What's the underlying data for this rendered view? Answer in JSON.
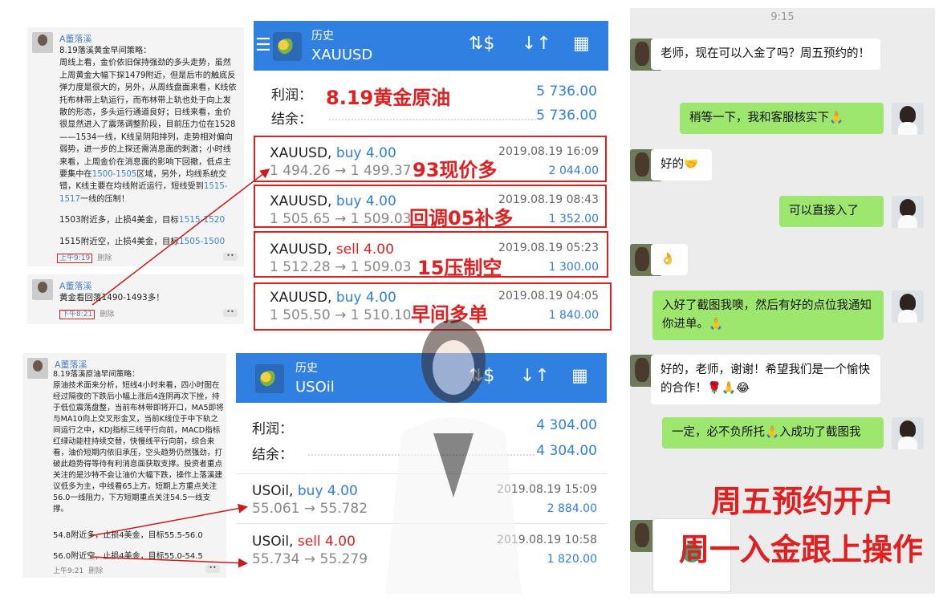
{
  "note1": {
    "author": "A董落溪",
    "body": "8.19落溪黄金早间策略：\n周线上看，金价依旧保持强劲的多头走势，虽然上周黄金大幅下探1479附近，但是后市的触底反弹力度是很大的，另外，从周线盘面来看，K线依托布林带上轨运行，而布林带上轨也处于向上发散的形态，多头运行通道良好；日线来看，金价很显然进入了震荡调整阶段，目前压力位在1528——1534一线，K线呈阴阳排列，走势相对偏向弱势，进一步的上探还需消息面的刺激；小时线来看，上周金价在消息面的影响下回撤，低点主要集中在",
    "body_hl1": "1500-1505",
    "body_mid": "区域，另外，均线系统交错，K线主要在均线附近运行，短线受到",
    "body_hl2": "1515-1517",
    "body_tail": "一线的压制！",
    "line1_a": "1503附近多，止损4美金，目标",
    "line1_b": "1515-1520",
    "line2_a": "1515附近空，止损4美金，目标",
    "line2_b": "1505-1500",
    "time": "上午9:19",
    "delete": "删除",
    "dots": "••"
  },
  "note2": {
    "author": "A董落溪",
    "body": "黄金看回落1490-1493多！",
    "time": "下午8:21",
    "delete": "删除",
    "dots": "••"
  },
  "note3": {
    "author": "A董落溪",
    "body": "8.19落溪原油早间策略：\n原油技术面来分析，短线4小时来看，四小时图在经过隔夜的下跌后小幅上涨后4连阴再次下挫，持于低位震荡盘整，当前布林带即将开口，MA5即将与MA10向上交叉形金叉，当前K线位于中下轨之间运行之中，KDJ指标三线平行向前，MACD指标红绿动能柱持续交替，快慢线平行向前，综合来看，油价短期内依旧承压，空头趋势仍然强劲，打破此趋势得等待有利消息面获取支撑。投资者重点关注的是沙特不会让油价大幅下跌，操作上落溪建议低多为主，中线看65上方。短期上方重点关注56.0一线阻力，下方短期重点关注54.5一线支撑。",
    "line1": "54.8附近多，止损4美金，目标55.5-56.0",
    "line2": "56.0附近空，止损4美金，目标55.0-54.5",
    "time": "上午9:21",
    "delete": "删除",
    "dots": "••"
  },
  "app1": {
    "menu_icon": "hamburger-icon",
    "title": "历史",
    "symbol": "XAUUSD",
    "profit_label": "利润：",
    "profit_value": "5 736.00",
    "balance_label": "结余：",
    "balance_value": "5 736.00",
    "annotation": "8.19黄金原油",
    "trades": [
      {
        "symbol": "XAUUSD,",
        "dir": "buy",
        "lots": "4.00",
        "prices": "1 494.26 → 1 499.37",
        "date": "2019.08.19 16:09",
        "profit": "2 044.00",
        "note": "93现价多"
      },
      {
        "symbol": "XAUUSD,",
        "dir": "buy",
        "lots": "4.00",
        "prices": "1 505.65 → 1 509.03",
        "date": "2019.08.19 08:43",
        "profit": "1 352.00",
        "note": "回调05补多"
      },
      {
        "symbol": "XAUUSD,",
        "dir": "sell",
        "lots": "4.00",
        "prices": "1 512.28 → 1 509.03",
        "date": "2019.08.19 05:23",
        "profit": "1 300.00",
        "note": "15压制空"
      },
      {
        "symbol": "XAUUSD,",
        "dir": "buy",
        "lots": "4.00",
        "prices": "1 505.50 → 1 510.10",
        "date": "2019.08.19 04:05",
        "profit": "1 840.00",
        "note": "早间多单"
      }
    ]
  },
  "app2": {
    "title": "历史",
    "symbol": "USOil",
    "profit_label": "利润：",
    "profit_value": "4 304.00",
    "balance_label": "结余：",
    "balance_value": "4 304.00",
    "trades": [
      {
        "symbol": "USOil,",
        "dir": "buy",
        "lots": "4.00",
        "prices": "55.061 → 55.782",
        "date": "2019.08.19 15:09",
        "profit": "2 884.00"
      },
      {
        "symbol": "USOil,",
        "dir": "sell",
        "lots": "4.00",
        "prices": "55.734 → 55.279",
        "date": "2019.08.19 10:58",
        "profit": "1 820.00"
      }
    ]
  },
  "chat": {
    "time": "9:15",
    "messages": [
      {
        "side": "in",
        "text": "老师，现在可以入金了吗？周五预约的！"
      },
      {
        "side": "out",
        "text": "稍等一下，我和客服核实下🙏"
      },
      {
        "side": "in",
        "text": "好的🤝"
      },
      {
        "side": "out",
        "text": "可以直接入了"
      },
      {
        "side": "in",
        "text": "👌"
      },
      {
        "side": "out",
        "text": "入好了截图我噢，然后有好的点位我通知你进单。🙏"
      },
      {
        "side": "in",
        "text": "好的，老师，谢谢！希望我们是一个愉快的合作！🌹🙏😂"
      },
      {
        "side": "out",
        "text": "一定，必不负所托🙏入成功了截图我"
      }
    ],
    "banner1": "周五预约开户",
    "banner2": "周一入金跟上操作"
  }
}
